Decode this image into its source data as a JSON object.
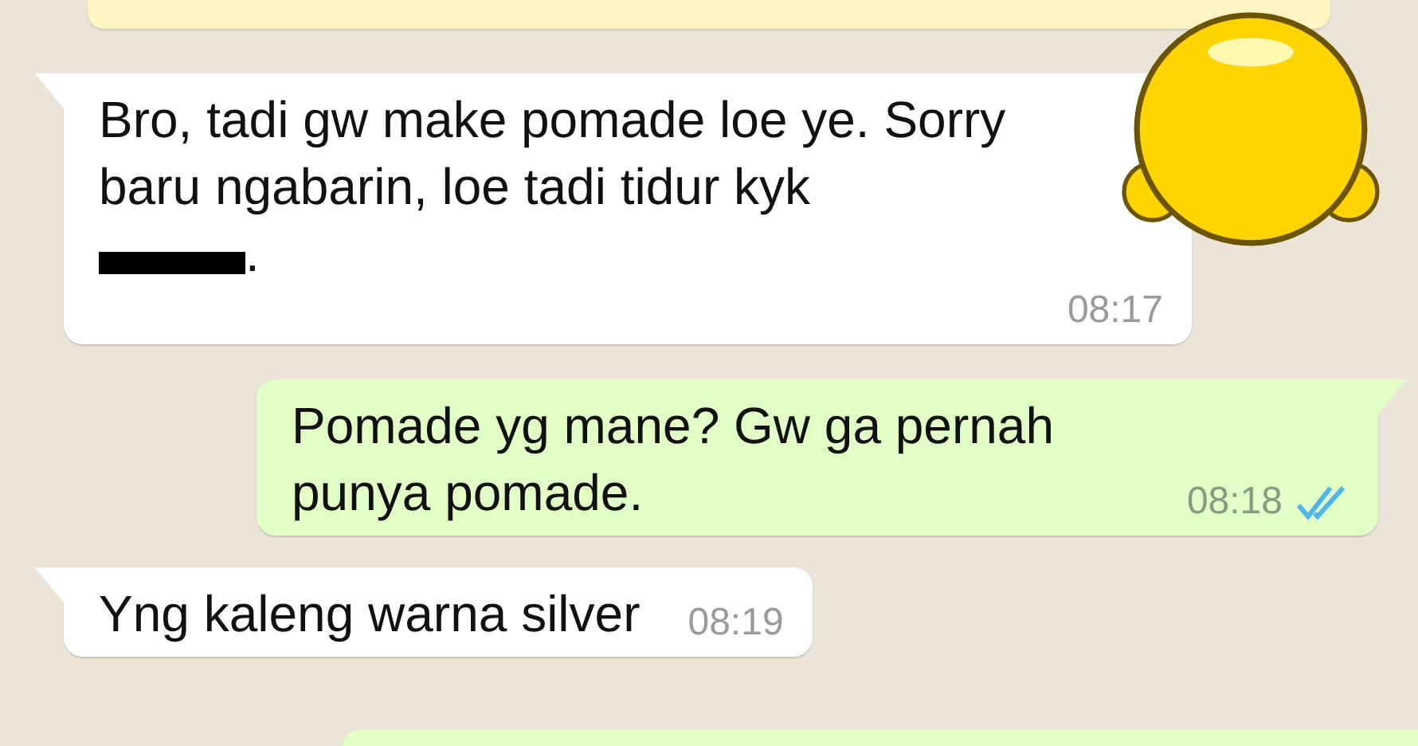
{
  "messages": [
    {
      "kind": "incoming",
      "text": "Bro, tadi gw make pomade loe ye. Sorry baru ngabarin, loe tadi tidur kyk",
      "redacted": true,
      "text_after": ".",
      "time": "08:17"
    },
    {
      "kind": "outgoing",
      "text": "Pomade yg mane? Gw ga pernah punya pomade.",
      "time": "08:18",
      "read": true
    },
    {
      "kind": "incoming",
      "text": "Yng kaleng warna silver",
      "time": "08:19"
    }
  ]
}
